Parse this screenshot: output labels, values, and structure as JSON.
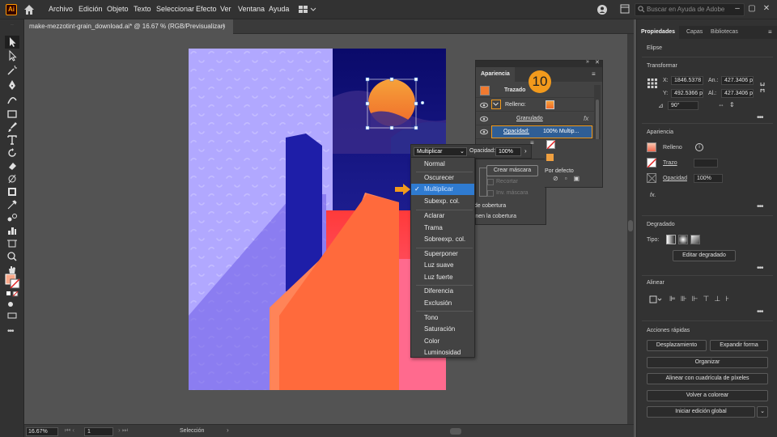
{
  "menubar": {
    "logo": "Ai",
    "items": [
      "Archivo",
      "Edición",
      "Objeto",
      "Texto",
      "Seleccionar",
      "Efecto",
      "Ver",
      "Ventana",
      "Ayuda"
    ],
    "search_placeholder": "Buscar en Ayuda de Adobe",
    "icons": [
      "home-icon",
      "workspace-switcher-icon",
      "user-icon",
      "arrange-docs-icon",
      "search-icon",
      "minimize-icon",
      "maximize-icon",
      "close-icon"
    ]
  },
  "document": {
    "tab_title": "make-mezzotint-grain_download.ai* @ 16.67 % (RGB/Previsualizar)",
    "close": "×"
  },
  "status": {
    "zoom": "16.67%",
    "page": "1",
    "mode": "Selección"
  },
  "right_panel": {
    "tabs": [
      "Propiedades",
      "Capas",
      "Bibliotecas"
    ],
    "object": "Elipse",
    "transform": {
      "title": "Transformar",
      "x_label": "X:",
      "x": "1846.5378",
      "y_label": "Y:",
      "y": "492.5366 p",
      "w_label": "An.:",
      "w": "427.3406 p",
      "h_label": "Al.:",
      "h": "427.3406 p",
      "angle": "90°"
    },
    "appearance": {
      "title": "Apariencia",
      "fill": "Relleno",
      "stroke": "Trazo",
      "opacity_label": "Opacidad",
      "opacity": "100%",
      "fx": "fx."
    },
    "gradient": {
      "title": "Degradado",
      "type_label": "Tipo:",
      "edit_button": "Editar degradado"
    },
    "align": {
      "title": "Alinear"
    },
    "quick_actions": {
      "title": "Acciones rápidas",
      "offset": "Desplazamiento",
      "expand": "Expandir forma",
      "arrange": "Organizar",
      "align_pixel": "Alinear con cuadrícula de píxeles",
      "recolor": "Volver a colorear",
      "global_edit": "Iniciar edición global"
    },
    "more": "•••"
  },
  "appearance_panel": {
    "tab": "Apariencia",
    "stroke_header": "Trazado",
    "fill_label": "Relleno:",
    "grain_label": "Granulado",
    "fx": "fx",
    "opacity_label": "Opacidad:",
    "opacity_value": "100% Multip...",
    "default_label": "Por defecto",
    "step_number": "10"
  },
  "blend_dropdown": {
    "selected": "Multiplicar",
    "opacity_label": "Opacidad:",
    "opacity_value": "100%",
    "mask_button": "Crear máscara",
    "clip": "Recortar",
    "invert_mask": "Inv. máscara",
    "cover_text1": "o de cobertura",
    "cover_text2": "efinen la cobertura",
    "groups": [
      [
        "Normal"
      ],
      [
        "Oscurecer",
        "Multiplicar",
        "Subexp. col."
      ],
      [
        "Aclarar",
        "Trama",
        "Sobreexp. col."
      ],
      [
        "Superponer",
        "Luz suave",
        "Luz fuerte"
      ],
      [
        "Diferencia",
        "Exclusión"
      ],
      [
        "Tono",
        "Saturación",
        "Color",
        "Luminosidad"
      ]
    ],
    "active_item": "Multiplicar",
    "check": "✓"
  },
  "colors": {
    "accent": "#f29a1c",
    "highlight": "#2f7bd1",
    "ui_dark": "#323232",
    "canvas_bg": "#535353"
  }
}
